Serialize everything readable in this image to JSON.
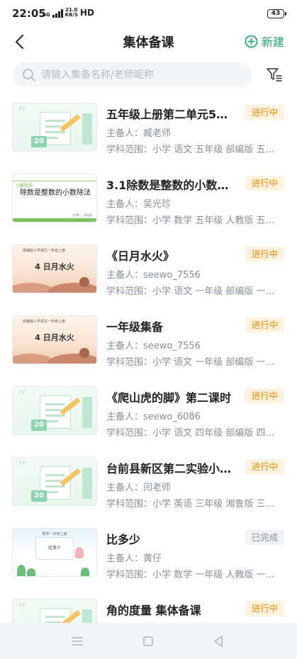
{
  "status_bar": {
    "time": "22:05",
    "network": "4G",
    "net_speed_value": "21.0",
    "net_speed_unit": "KB/S",
    "hd": "HD",
    "battery": "43"
  },
  "nav": {
    "title": "集体备课",
    "new_label": "新建",
    "accent_color": "#1fa96b"
  },
  "search": {
    "placeholder": "请输入集备名称/老师昵称",
    "value": ""
  },
  "items": [
    {
      "title": "五年级上册第二单元5…",
      "owner": "主备人：臧老师",
      "scope": "学科范围：小学 语文 五年级 部编版 五…",
      "status": "进行中",
      "thumb": "green-default",
      "thumb_year": "20"
    },
    {
      "title": "3.1除数是整数的小数…",
      "owner": "主备人：吴光珍",
      "scope": "学科范围：小学 数学 五年级 人教版 五…",
      "status": "进行中",
      "thumb": "slide",
      "thumb_logo": "小数除法",
      "thumb_text": "除数是整数的小数除法",
      "thumb_foot": "主讲人：吴光珍"
    },
    {
      "title": "《日月水火》",
      "owner": "主备人：seewo_7556",
      "scope": "学科范围：小学 语文 一年级 部编版 一…",
      "status": "进行中",
      "thumb": "sunset",
      "thumb_header": "部编版小学语文一年级上册",
      "thumb_text": "4 日月水火"
    },
    {
      "title": "一年级集备",
      "owner": "主备人：seewo_7556",
      "scope": "学科范围：小学 语文 一年级 部编版 一…",
      "status": "进行中",
      "thumb": "sunset",
      "thumb_header": "部编版小学语文一年级上册",
      "thumb_text": "4 日月水火"
    },
    {
      "title": "《爬山虎的脚》第二课时",
      "owner": "主备人：seewo_6086",
      "scope": "学科范围：小学 语文 四年级 部编版 四…",
      "status": "进行中",
      "thumb": "green-default",
      "thumb_year": "20"
    },
    {
      "title": "台前县新区第二实验小…",
      "owner": "主备人：闫老师",
      "scope": "学科范围：小学 英语 三年级 湘鲁版 三…",
      "status": "进行中",
      "thumb": "green-default",
      "thumb_year": "20"
    },
    {
      "title": "比多少",
      "owner": "主备人：黄仔",
      "scope": "学科范围：小学 数学 一年级 人教版 一…",
      "status": "已完成",
      "thumb": "blue",
      "thumb_header": "数学一年级上册",
      "thumb_text": "比多少"
    },
    {
      "title": "角的度量 集体备课",
      "owner": "",
      "scope": "",
      "status": "进行中",
      "thumb": "green-default",
      "thumb_year": "20"
    }
  ],
  "colors": {
    "in_progress_text": "#f28a00",
    "in_progress_bg": "#fff3e0",
    "done_text": "#8c929a",
    "done_bg": "#f0f2f5"
  },
  "system_nav": [
    "menu-icon",
    "home-icon",
    "back-icon"
  ]
}
